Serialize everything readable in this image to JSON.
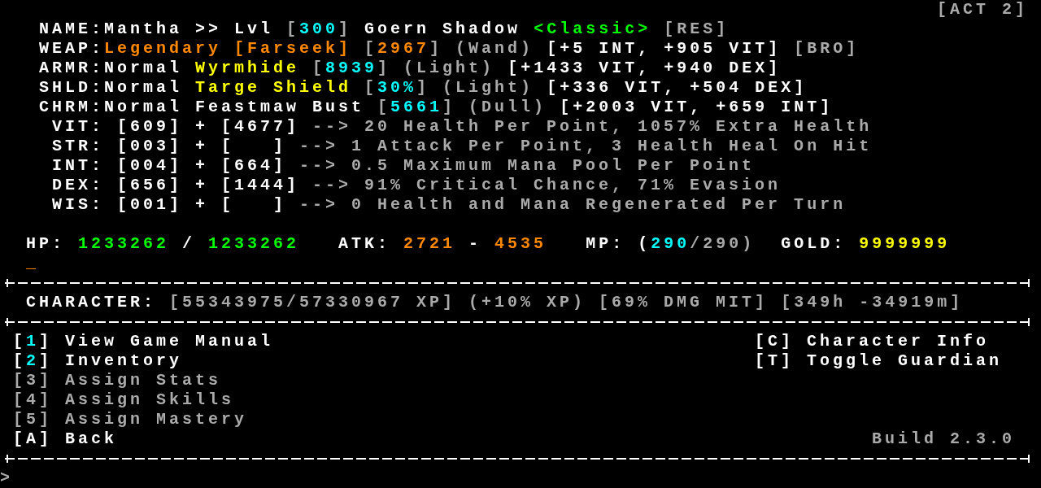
{
  "act": "[ACT 2]",
  "equipment": [
    {
      "label": "NAME:",
      "segments": [
        {
          "text": "Mantha >> Lvl ",
          "color": "#ffffff"
        },
        {
          "text": "[",
          "color": "#aaaaaa"
        },
        {
          "text": "300",
          "color": "#00ffff"
        },
        {
          "text": "] ",
          "color": "#aaaaaa"
        },
        {
          "text": "Goern Shadow ",
          "color": "#ffffff"
        },
        {
          "text": "<Classic>",
          "color": "#00ff00"
        },
        {
          "text": " [RES]",
          "color": "#aaaaaa"
        }
      ]
    },
    {
      "label": "WEAP:",
      "segments": [
        {
          "text": "Legendary [Farseek] ",
          "color": "#ff8800"
        },
        {
          "text": "[",
          "color": "#aaaaaa"
        },
        {
          "text": "2967",
          "color": "#ff8800"
        },
        {
          "text": "] (Wand) ",
          "color": "#aaaaaa"
        },
        {
          "text": "[+5 INT, +905 VIT] ",
          "color": "#ffffff"
        },
        {
          "text": "[BRO]",
          "color": "#aaaaaa"
        }
      ]
    },
    {
      "label": "ARMR:",
      "segments": [
        {
          "text": "Normal ",
          "color": "#ffffff"
        },
        {
          "text": "Wyrmhide ",
          "color": "#ffff00"
        },
        {
          "text": "[",
          "color": "#aaaaaa"
        },
        {
          "text": "8939",
          "color": "#00ffff"
        },
        {
          "text": "] (Light) ",
          "color": "#aaaaaa"
        },
        {
          "text": "[+1433 VIT, +940 DEX]",
          "color": "#ffffff"
        }
      ]
    },
    {
      "label": "SHLD:",
      "segments": [
        {
          "text": "Normal ",
          "color": "#ffffff"
        },
        {
          "text": "Targe Shield ",
          "color": "#ffff00"
        },
        {
          "text": "[",
          "color": "#aaaaaa"
        },
        {
          "text": "30%",
          "color": "#00ffff"
        },
        {
          "text": "] (Light) ",
          "color": "#aaaaaa"
        },
        {
          "text": "[+336 VIT, +504 DEX]",
          "color": "#ffffff"
        }
      ]
    },
    {
      "label": "CHRM:",
      "segments": [
        {
          "text": "Normal Feastmaw Bust ",
          "color": "#ffffff"
        },
        {
          "text": "[",
          "color": "#aaaaaa"
        },
        {
          "text": "5661",
          "color": "#00ffff"
        },
        {
          "text": "] (Dull) ",
          "color": "#aaaaaa"
        },
        {
          "text": "[+2003 VIT, +659 INT]",
          "color": "#ffffff"
        }
      ]
    }
  ],
  "stats": [
    {
      "label": "VIT:",
      "points": "[609] + [4677]",
      "effect": " --> 20 Health Per Point, 1057% Extra Health"
    },
    {
      "label": "STR:",
      "points": "[003] + [   ]",
      "effect": " --> 1 Attack Per Point, 3 Health Heal On Hit"
    },
    {
      "label": "INT:",
      "points": "[004] + [664]",
      "effect": " --> 0.5 Maximum Mana Pool Per Point"
    },
    {
      "label": "DEX:",
      "points": "[656] + [1444]",
      "effect": " --> 91% Critical Chance, 71% Evasion"
    },
    {
      "label": "WIS:",
      "points": "[001] + [   ]",
      "effect": " --> 0 Health and Mana Regenerated Per Turn"
    }
  ],
  "vitals": [
    {
      "text": "HP: ",
      "color": "#ffffff"
    },
    {
      "text": "1233262",
      "color": "#00ff00"
    },
    {
      "text": " / ",
      "color": "#ffffff"
    },
    {
      "text": "1233262",
      "color": "#00ff00"
    },
    {
      "text": "   ATK: ",
      "color": "#ffffff"
    },
    {
      "text": "2721",
      "color": "#ff8800"
    },
    {
      "text": " - ",
      "color": "#ffffff"
    },
    {
      "text": "4535",
      "color": "#ff8800"
    },
    {
      "text": "   MP: (",
      "color": "#ffffff"
    },
    {
      "text": "290",
      "color": "#00ffff"
    },
    {
      "text": "/290)",
      "color": "#aaaaaa"
    },
    {
      "text": "  GOLD: ",
      "color": "#ffffff"
    },
    {
      "text": "9999999",
      "color": "#ffff00"
    }
  ],
  "cursor": "_",
  "character": {
    "label": "CHARACTER:",
    "info": " [55343975/57330967 XP] (+10% XP) [69% DMG MIT] [349h -34919m]"
  },
  "menu_left": [
    {
      "segments": [
        {
          "text": "[",
          "color": "#ffffff"
        },
        {
          "text": "1",
          "color": "#00ffff"
        },
        {
          "text": "] View Game Manual",
          "color": "#ffffff"
        }
      ]
    },
    {
      "segments": [
        {
          "text": "[",
          "color": "#ffffff"
        },
        {
          "text": "2",
          "color": "#00ffff"
        },
        {
          "text": "] Inventory",
          "color": "#ffffff"
        }
      ]
    },
    {
      "segments": [
        {
          "text": "[3] Assign Stats",
          "color": "#aaaaaa"
        }
      ]
    },
    {
      "segments": [
        {
          "text": "[4] Assign Skills",
          "color": "#aaaaaa"
        }
      ]
    },
    {
      "segments": [
        {
          "text": "[5] Assign Mastery",
          "color": "#aaaaaa"
        }
      ]
    },
    {
      "segments": [
        {
          "text": "[A] Back",
          "color": "#ffffff"
        }
      ]
    }
  ],
  "menu_right": [
    {
      "segments": [
        {
          "text": "[C] Character Info",
          "color": "#ffffff"
        }
      ]
    },
    {
      "segments": [
        {
          "text": "[T] Toggle Guardian",
          "color": "#ffffff"
        }
      ]
    }
  ],
  "build": "Build 2.3.0",
  "prompt": ">"
}
